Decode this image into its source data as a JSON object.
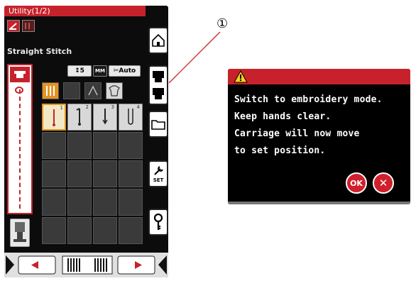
{
  "screen": {
    "title": "Utility(1/2)",
    "stitch_name": "Straight Stitch",
    "chips": {
      "width_value": "5",
      "foot_label": "MM",
      "tension_label": "Auto"
    },
    "stitch_numbers": [
      "1",
      "2",
      "3",
      "4"
    ],
    "colors": {
      "accent": "#c7222c",
      "selected": "#e39423",
      "background": "#0c0c0c"
    }
  },
  "right_buttons": {
    "home": "home-icon",
    "mode": "embroidery-mode-icon",
    "open_file": "folder-icon",
    "settings": "SET",
    "key": "key-icon"
  },
  "navbar": {
    "prev": "page-prev-arrow",
    "next": "page-next-arrow"
  },
  "callout": {
    "number": "①"
  },
  "dialog": {
    "lines": [
      "Switch to embroidery mode.",
      "Keep hands clear.",
      "Carriage will now move",
      "to set position."
    ],
    "ok_label": "OK",
    "cancel_label": "✕"
  }
}
